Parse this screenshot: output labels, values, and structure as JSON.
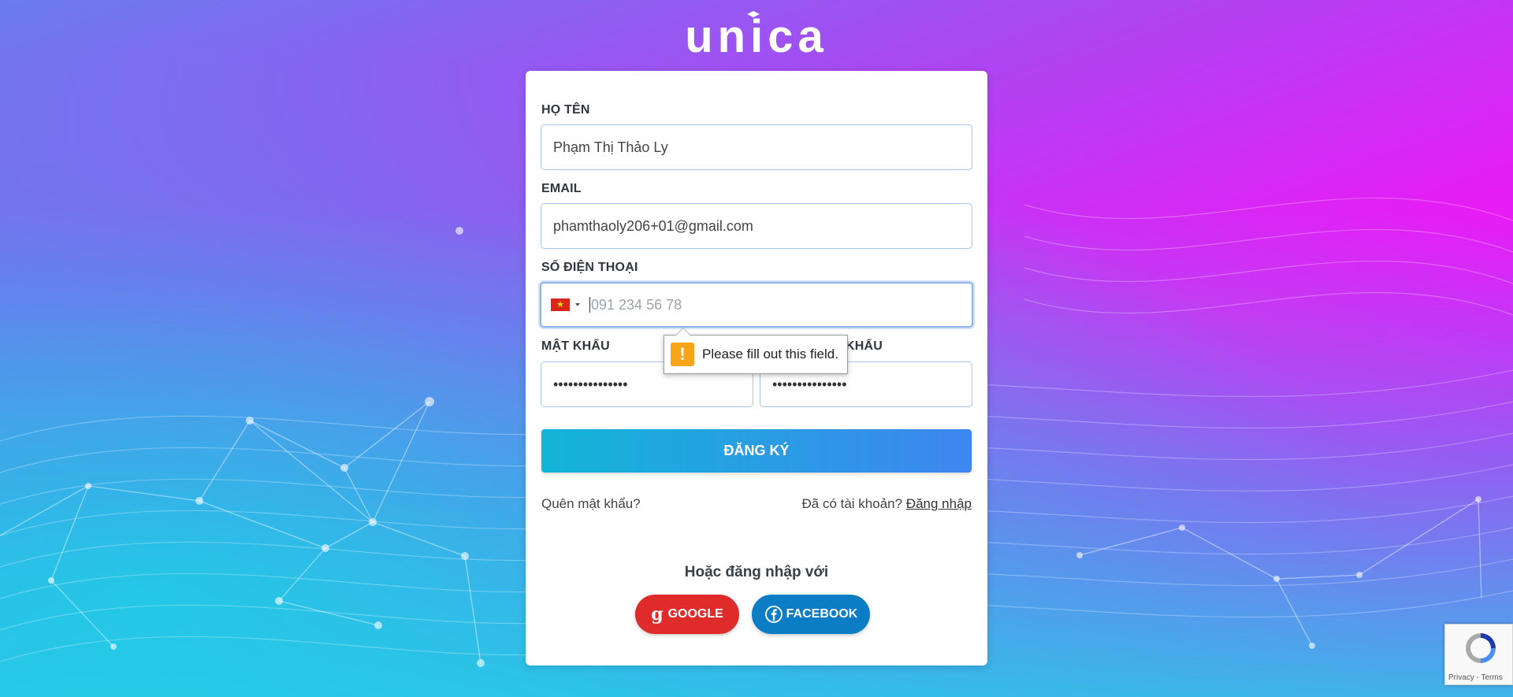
{
  "brand": {
    "logo_text": "unica",
    "accent_color": "#3e86f0",
    "background_colors": [
      "#b043f2",
      "#ff00ff",
      "#28bee6"
    ]
  },
  "form": {
    "name": {
      "label": "HỌ TÊN",
      "value": "Phạm Thị Thảo Ly"
    },
    "email": {
      "label": "EMAIL",
      "value": "phamthaoly206+01@gmail.com"
    },
    "phone": {
      "label": "SỐ ĐIỆN THOẠI",
      "country_icon": "vietnam-flag-icon",
      "placeholder": "091 234 56 78",
      "value": ""
    },
    "password": {
      "label": "MẬT KHẨU",
      "value": "•••••••••••••••"
    },
    "confirm_password": {
      "label_visible": "KHẨU",
      "value": "•••••••••••••••"
    },
    "validation_tooltip": {
      "icon": "warning-icon",
      "text": "Please fill out this field."
    },
    "submit_label": "ĐĂNG KÝ"
  },
  "links": {
    "forgot_password": "Quên mật khẩu?",
    "have_account": "Đã có tài khoản?",
    "login": "Đăng nhập"
  },
  "social": {
    "heading": "Hoặc đăng nhập với",
    "google_label": "GOOGLE",
    "google_color": "#e02b2b",
    "facebook_label": "FACEBOOK",
    "facebook_color": "#0b7dc4"
  },
  "recaptcha": {
    "text": "Privacy - Terms"
  }
}
